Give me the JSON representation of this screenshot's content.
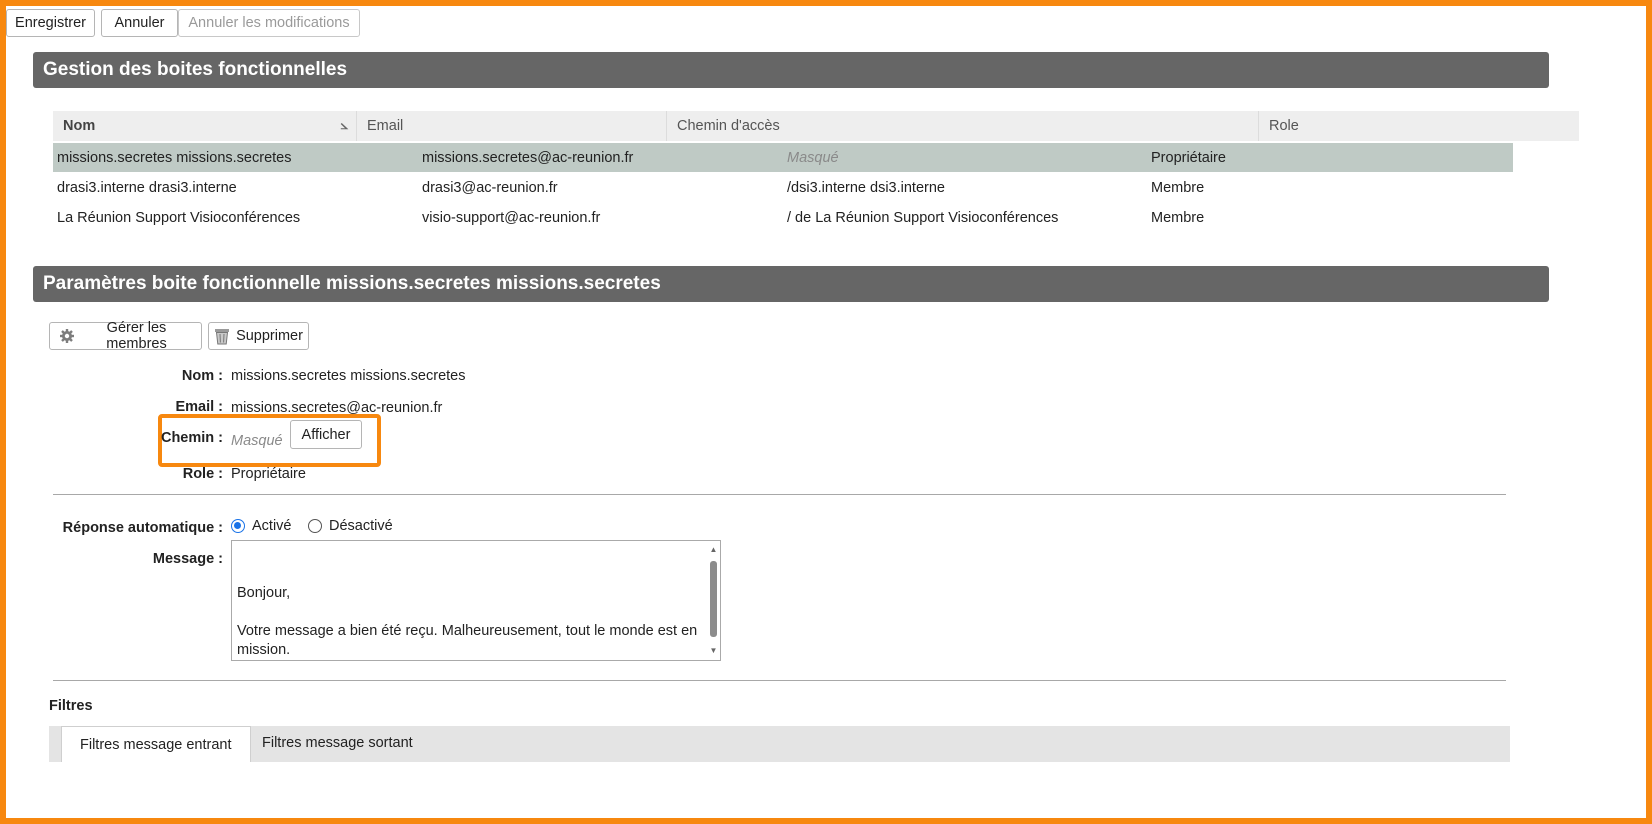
{
  "toolbar": {
    "save_label": "Enregistrer",
    "cancel_label": "Annuler",
    "revert_label": "Annuler les modifications"
  },
  "section1": {
    "title": "Gestion des boites fonctionnelles"
  },
  "grid": {
    "columns": [
      "Nom",
      "Email",
      "Chemin d'accès",
      "Role"
    ],
    "sort_indicator": "⦣",
    "rows": [
      {
        "name": "missions.secretes missions.secretes",
        "email": "missions.secretes@ac-reunion.fr",
        "path": "Masqué",
        "role": "Propriétaire"
      },
      {
        "name": "drasi3.interne drasi3.interne",
        "email": "drasi3@ac-reunion.fr",
        "path": "/dsi3.interne dsi3.interne",
        "role": "Membre"
      },
      {
        "name": "La Réunion Support Visioconférences",
        "email": "visio-support@ac-reunion.fr",
        "path": "/ de La Réunion Support Visioconférences",
        "role": "Membre"
      }
    ]
  },
  "section2": {
    "title": "Paramètres boite fonctionnelle missions.secretes missions.secretes"
  },
  "actions": {
    "manage_members_label": "Gérer les membres",
    "delete_label": "Supprimer"
  },
  "details": {
    "name_label": "Nom :",
    "name_value": "missions.secretes missions.secretes",
    "email_label": "Email :",
    "email_value": "missions.secretes@ac-reunion.fr",
    "path_label": "Chemin :",
    "path_value": "Masqué",
    "show_button_label": "Afficher",
    "role_label": "Role :",
    "role_value": "Propriétaire"
  },
  "autoreply": {
    "label": "Réponse automatique :",
    "option_on": "Activé",
    "option_off": "Désactivé",
    "selected": "Activé",
    "message_label": "Message :",
    "message_text": "Bonjour,\n\nVotre message a bien été reçu. Malheureusement, tout le monde est en mission.\nSi c’est urgent, fuyez. Si ça ne l’est pas, attendez."
  },
  "filters": {
    "title": "Filtres",
    "tabs": [
      "Filtres message entrant",
      "Filtres message sortant"
    ],
    "active_tab": "Filtres message entrant"
  },
  "colors": {
    "highlight": "#f7880f",
    "section_bar": "#666666",
    "selected_row": "#bfcac5"
  }
}
